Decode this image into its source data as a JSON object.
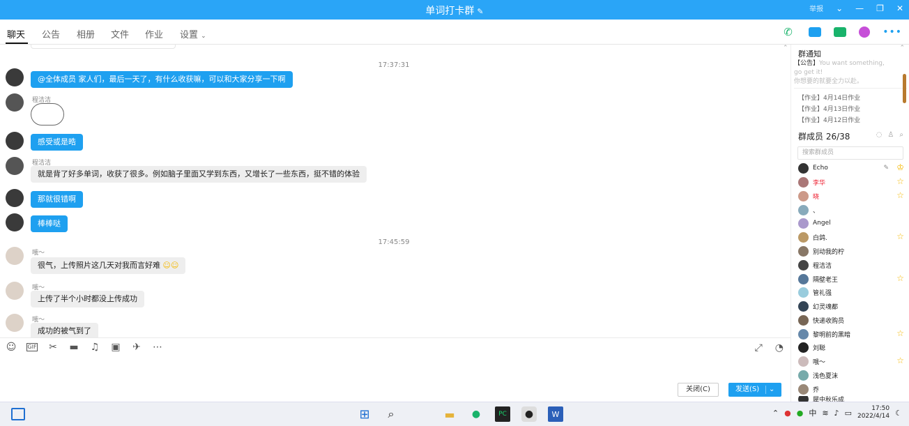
{
  "window": {
    "title": "单词打卡群",
    "report": "举报"
  },
  "tabs": [
    {
      "label": "聊天"
    },
    {
      "label": "公告"
    },
    {
      "label": "相册"
    },
    {
      "label": "文件"
    },
    {
      "label": "作业"
    },
    {
      "label": "设置"
    }
  ],
  "messages": {
    "t1": "17:37:31",
    "m1": "@全体成员 家人们，最后一天了，有什么收获嘛，可以和大家分享一下啊",
    "s2": "程洁洁",
    "m3": "感受或是晧",
    "s4": "程洁洁",
    "m4": "就是背了好多单词，收获了很多。例如脑子里面又学到东西，又增长了一些东西，挺不错的体验",
    "m5": "那就很错啊",
    "m6": "棒棒哒",
    "t2": "17:45:59",
    "s7": "哦～",
    "m7": "很气，上传照片这几天对我而言好难",
    "s8": "哦～",
    "m8": "上传了半个小时都没上传成功",
    "s9": "哦～",
    "m9": "成功的被气到了"
  },
  "composer": {
    "close": "关闭(C)",
    "send": "发送(S)"
  },
  "side": {
    "notice_title": "群通知",
    "notice_prefix": "【公告】",
    "notice_text1": "You want something,",
    "notice_text2": "go get it!",
    "notice_text3": "你想要的就要全力以赴。",
    "homework": [
      "【作业】4月14日作业",
      "【作业】4月13日作业",
      "【作业】4月12日作业"
    ],
    "members_title": "群成员 26/38",
    "search_placeholder": "搜索群成员",
    "members": [
      {
        "name": "Echo",
        "color": "#333"
      },
      {
        "name": "李华",
        "color": "#a77"
      },
      {
        "name": "晓",
        "color": "#c98"
      },
      {
        "name": "、",
        "color": "#8ab"
      },
      {
        "name": "Angel",
        "color": "#a9c"
      },
      {
        "name": "白鸽.",
        "color": "#b96"
      },
      {
        "name": "别动我的柠",
        "color": "#876"
      },
      {
        "name": "程洁洁",
        "color": "#444"
      },
      {
        "name": "隔壁老王",
        "color": "#579"
      },
      {
        "name": "管礼强",
        "color": "#9cd"
      },
      {
        "name": "幻灵魂都",
        "color": "#345"
      },
      {
        "name": "快递收购员",
        "color": "#765"
      },
      {
        "name": "黎明前的黑暗",
        "color": "#68a"
      },
      {
        "name": "刘聪",
        "color": "#222"
      },
      {
        "name": "哦～",
        "color": "#cbb"
      },
      {
        "name": "浅色夏沫",
        "color": "#7aa"
      },
      {
        "name": "乔",
        "color": "#987"
      },
      {
        "name": "犀中秋乐成",
        "color": "#333"
      }
    ]
  },
  "taskbar": {
    "ime": "中",
    "time": "17:50",
    "date": "2022/4/14"
  },
  "colors": {
    "title_bar": "#2aa5f7",
    "accent": "#1ea0f0",
    "star": "#f5b800"
  }
}
